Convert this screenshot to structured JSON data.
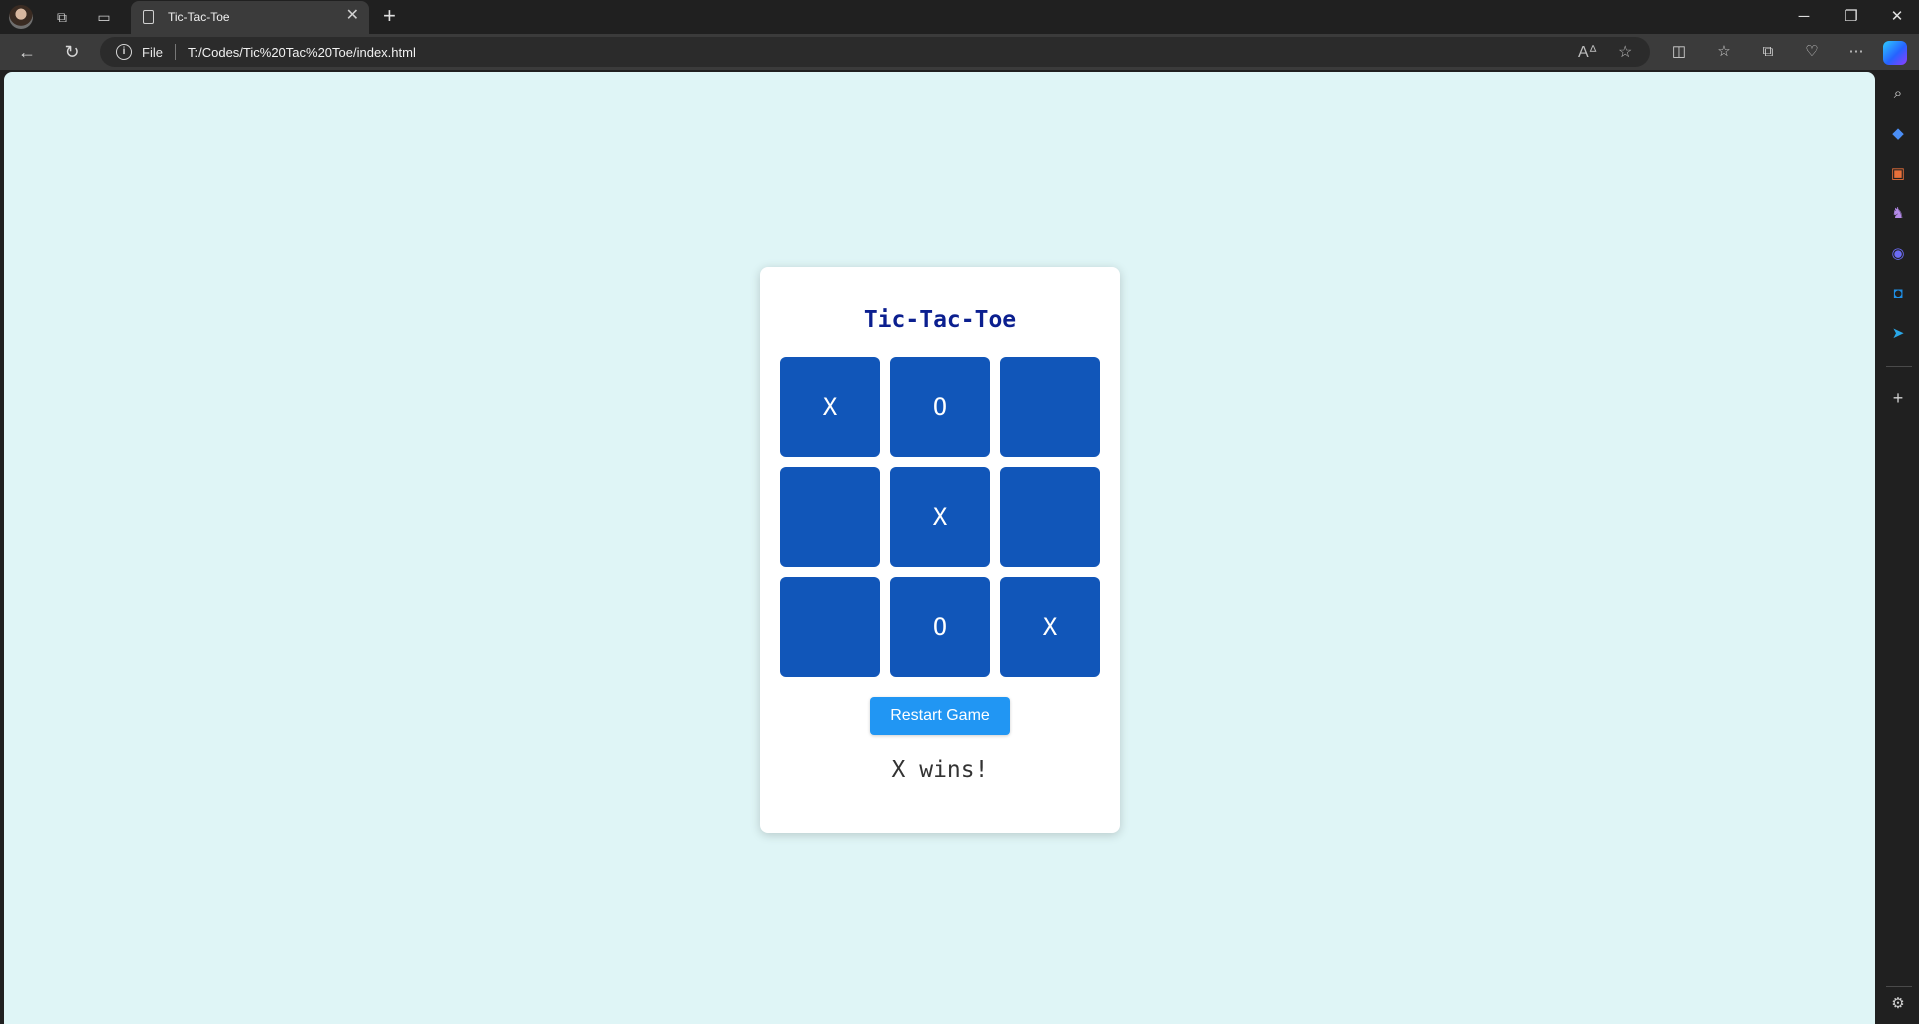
{
  "browser": {
    "tab_title": "Tic-Tac-Toe",
    "tab_close": "✕",
    "new_tab": "+",
    "file_label": "File",
    "url": "T:/Codes/Tic%20Tac%20Toe/index.html",
    "window_controls": {
      "minimize": "─",
      "restore": "❐",
      "close": "✕"
    },
    "nav": {
      "back": "←",
      "refresh": "↻"
    },
    "toolbar_icons": [
      "read-aloud-icon",
      "favorite-star-icon",
      "split-screen-icon",
      "favorites-icon",
      "collections-icon",
      "browser-essentials-icon",
      "more-icon"
    ],
    "sidebar_icons": [
      "search-icon",
      "shopping-tag-icon",
      "tools-icon",
      "games-icon",
      "copilot-icon",
      "outlook-icon",
      "telegram-icon",
      "add-icon",
      "settings-icon"
    ]
  },
  "game": {
    "title": "Tic-Tac-Toe",
    "board": [
      "X",
      "O",
      "",
      "",
      "X",
      "",
      "",
      "O",
      "X"
    ],
    "restart_label": "Restart Game",
    "status": "X wins!"
  },
  "colors": {
    "page_bg": "#dff5f6",
    "cell_bg": "#1156b9",
    "button_bg": "#2196f3",
    "title_color": "#0b1f8f"
  }
}
